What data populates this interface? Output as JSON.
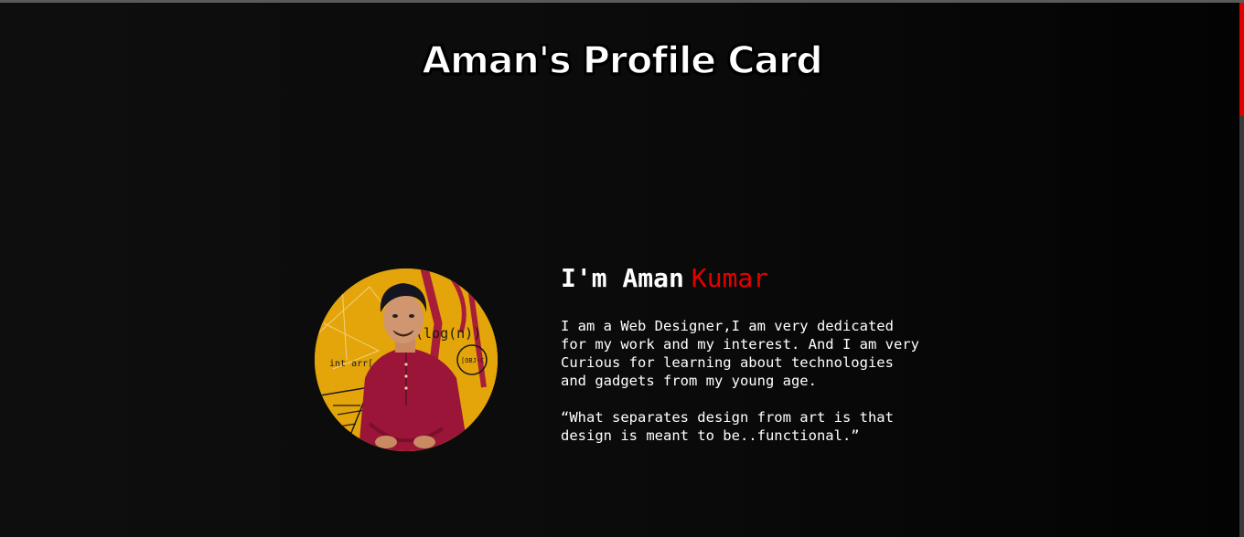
{
  "header": {
    "title": "Aman's Profile Card"
  },
  "profile": {
    "greeting_first": "I'm Aman",
    "greeting_last": "Kumar",
    "bio": "I am a Web Designer,I am very dedicated for my work and my interest. And I am very Curious for learning about technologies and gadgets from my young age.",
    "quote": "“What separates design from art is that design is meant to be..functional.”",
    "photo_text": {
      "log": "(log(n))",
      "arr": "int arr[",
      "obj": "[OBJ-C]"
    }
  },
  "colors": {
    "accent": "#e60000",
    "background": "#0c0c0c",
    "photo_background": "#e4a50a",
    "shirt": "#9a1538"
  }
}
